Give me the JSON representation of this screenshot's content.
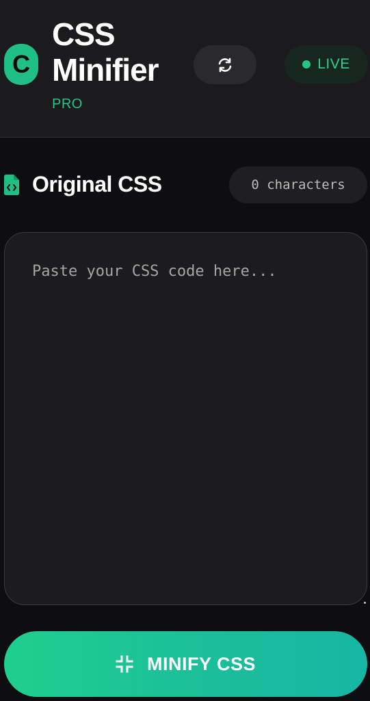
{
  "header": {
    "logo_letter": "C",
    "title": "CSS Minifier",
    "subtitle": "PRO",
    "refresh_icon": "refresh-icon",
    "status_label": "LIVE",
    "status_color": "#27c484"
  },
  "section": {
    "icon": "css-file-icon",
    "title": "Original CSS",
    "char_count": "0 characters"
  },
  "editor": {
    "value": "",
    "placeholder": "Paste your CSS code here..."
  },
  "action": {
    "icon": "compress-icon",
    "label": "MINIFY CSS"
  },
  "colors": {
    "accent": "#1fcf8e",
    "background": "#0e0e10",
    "panel": "#1b1b1d"
  }
}
